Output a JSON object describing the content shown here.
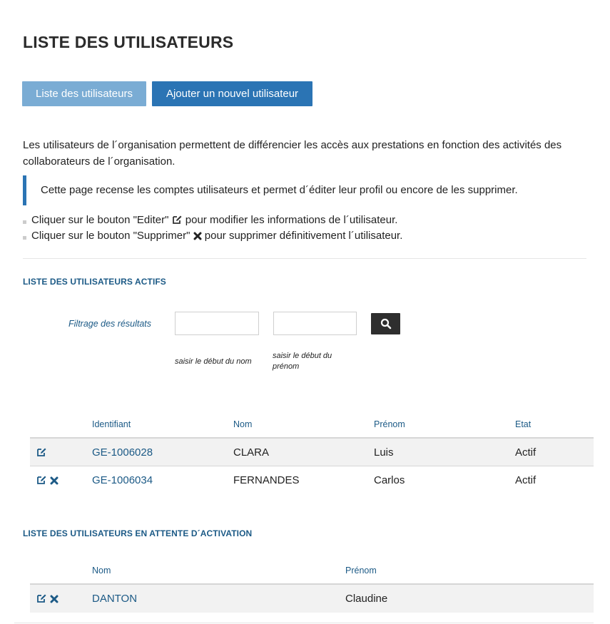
{
  "header": {
    "title": "LISTE DES UTILISATEURS"
  },
  "toolbar": {
    "list_label": "Liste des utilisateurs",
    "add_label": "Ajouter un nouvel utilisateur"
  },
  "intro": "Les utilisateurs de l´organisation permettent de différencier les accès aux prestations en fonction des activités des collaborateurs de l´organisation.",
  "callout": "Cette page recense les comptes utilisateurs et permet d´éditer leur profil ou encore de les supprimer.",
  "instructions": {
    "edit": {
      "before": "Cliquer sur le bouton \"Editer\"",
      "after": "pour modifier les informations de l´utilisateur."
    },
    "delete": {
      "before": "Cliquer sur le bouton \"Supprimer\"",
      "after": "pour supprimer définitivement l´utilisateur."
    }
  },
  "active_section": {
    "title": "LISTE DES UTILISATEURS ACTIFS",
    "filter": {
      "label": "Filtrage des résultats",
      "name_value": "",
      "firstname_value": "",
      "name_hint": "saisir le début du nom",
      "firstname_hint": "saisir le début du prénom"
    },
    "columns": [
      "Identifiant",
      "Nom",
      "Prénom",
      "Etat"
    ],
    "rows": [
      {
        "id": "GE-1006028",
        "nom": "CLARA",
        "prenom": "Luis",
        "etat": "Actif",
        "deletable": false
      },
      {
        "id": "GE-1006034",
        "nom": "FERNANDES",
        "prenom": "Carlos",
        "etat": "Actif",
        "deletable": true
      }
    ]
  },
  "pending_section": {
    "title": "LISTE DES UTILISATEURS EN ATTENTE D´ACTIVATION",
    "columns": [
      "Nom",
      "Prénom"
    ],
    "rows": [
      {
        "nom": "DANTON",
        "prenom": "Claudine"
      }
    ]
  },
  "colors": {
    "accent": "#2b74b4",
    "accent_light": "#7aacd4",
    "link": "#1c5a86",
    "row_shade": "#f2f2f2"
  },
  "icons": {
    "edit": "edit-icon",
    "delete": "delete-icon",
    "search": "search-icon"
  }
}
